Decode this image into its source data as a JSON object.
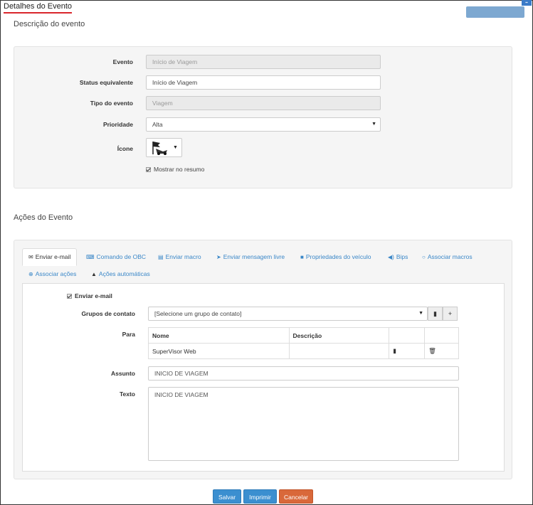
{
  "window": {
    "title": "Detalhes do Evento"
  },
  "description_section": {
    "title": "Descrição do evento",
    "fields": {
      "evento": {
        "label": "Evento",
        "value": "Início de Viagem"
      },
      "status": {
        "label": "Status equivalente",
        "value": "Início de Viagem"
      },
      "tipo": {
        "label": "Tipo do evento",
        "value": "Viagem"
      },
      "prioridade": {
        "label": "Prioridade",
        "value": "Alta"
      },
      "icone": {
        "label": "Ícone"
      }
    },
    "show_summary": {
      "label": "Mostrar no resumo",
      "checked": true
    }
  },
  "actions_section": {
    "title": "Ações do Evento",
    "tabs": [
      {
        "label": "Enviar e-mail",
        "icon": "envelope-icon",
        "active": true
      },
      {
        "label": "Comando de OBC",
        "icon": "keyboard-icon"
      },
      {
        "label": "Enviar macro",
        "icon": "list-icon"
      },
      {
        "label": "Enviar mensagem livre",
        "icon": "send-icon"
      },
      {
        "label": "Propriedades do veículo",
        "icon": "truck-icon"
      },
      {
        "label": "Bips",
        "icon": "volume-icon"
      },
      {
        "label": "Associar macros",
        "icon": "circle-icon"
      },
      {
        "label": "Associar ações",
        "icon": "plus-circle-icon"
      },
      {
        "label": "Ações automáticas",
        "icon": "warning-icon"
      }
    ],
    "email": {
      "send_checkbox": {
        "label": "Enviar e-mail",
        "checked": true
      },
      "groups": {
        "label": "Grupos de contato",
        "value": "[Selecione um grupo de contato]"
      },
      "para": {
        "label": "Para",
        "columns": [
          "Nome",
          "Descrição"
        ],
        "rows": [
          {
            "nome": "SuperVisor Web",
            "descricao": ""
          }
        ]
      },
      "assunto": {
        "label": "Assunto",
        "value": "INICIO DE VIAGEM"
      },
      "texto": {
        "label": "Texto",
        "value": "INICIO DE VIAGEM"
      }
    }
  },
  "footer": {
    "save": "Salvar",
    "print": "Imprimir",
    "cancel": "Cancelar"
  }
}
